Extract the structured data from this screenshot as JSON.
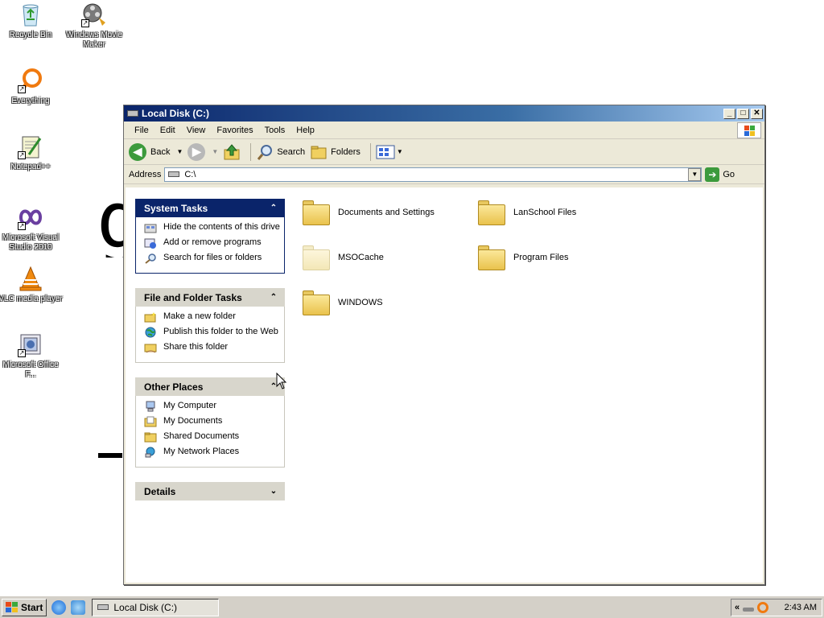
{
  "desktop": {
    "icons": [
      {
        "label": "Recycle Bin",
        "icon": "recycle-bin-icon"
      },
      {
        "label": "Windows Movie Maker",
        "icon": "movie-maker-icon"
      },
      {
        "label": "Everything",
        "icon": "everything-search-icon"
      },
      {
        "label": "Notepad++",
        "icon": "notepad-plus-plus-icon"
      },
      {
        "label": "Microsoft Visual Studio 2010",
        "icon": "visual-studio-icon"
      },
      {
        "label": "VLC media player",
        "icon": "vlc-icon"
      },
      {
        "label": "Microsoft Office F...",
        "icon": "office-icon"
      }
    ],
    "background_glyph": "g"
  },
  "window": {
    "title": "Local Disk (C:)",
    "controls": {
      "minimize": "_",
      "maximize": "□",
      "close": "✕"
    },
    "menu": [
      "File",
      "Edit",
      "View",
      "Favorites",
      "Tools",
      "Help"
    ],
    "toolbar": {
      "back": "Back",
      "search": "Search",
      "folders": "Folders"
    },
    "address": {
      "label": "Address",
      "value": "C:\\",
      "go": "Go"
    },
    "tasks": {
      "system": {
        "title": "System Tasks",
        "items": [
          "Hide the contents of this drive",
          "Add or remove programs",
          "Search for files or folders"
        ]
      },
      "file_folder": {
        "title": "File and Folder Tasks",
        "items": [
          "Make a new folder",
          "Publish this folder to the Web",
          "Share this folder"
        ]
      },
      "other": {
        "title": "Other Places",
        "items": [
          "My Computer",
          "My Documents",
          "Shared Documents",
          "My Network Places"
        ]
      },
      "details": {
        "title": "Details"
      }
    },
    "files": [
      {
        "name": "Documents and Settings",
        "hidden": false
      },
      {
        "name": "LanSchool Files",
        "hidden": false
      },
      {
        "name": "MSOCache",
        "hidden": true
      },
      {
        "name": "Program Files",
        "hidden": false
      },
      {
        "name": "WINDOWS",
        "hidden": false
      }
    ]
  },
  "taskbar": {
    "start": "Start",
    "task": "Local Disk (C:)",
    "tray_arrows": "«",
    "clock": "2:43 AM"
  },
  "colors": {
    "titlebar": "#0a246a",
    "panel_header_blue": "#0a246a",
    "folder_yellow": "#e9c24c",
    "taskbar": "#d4d0c8"
  }
}
